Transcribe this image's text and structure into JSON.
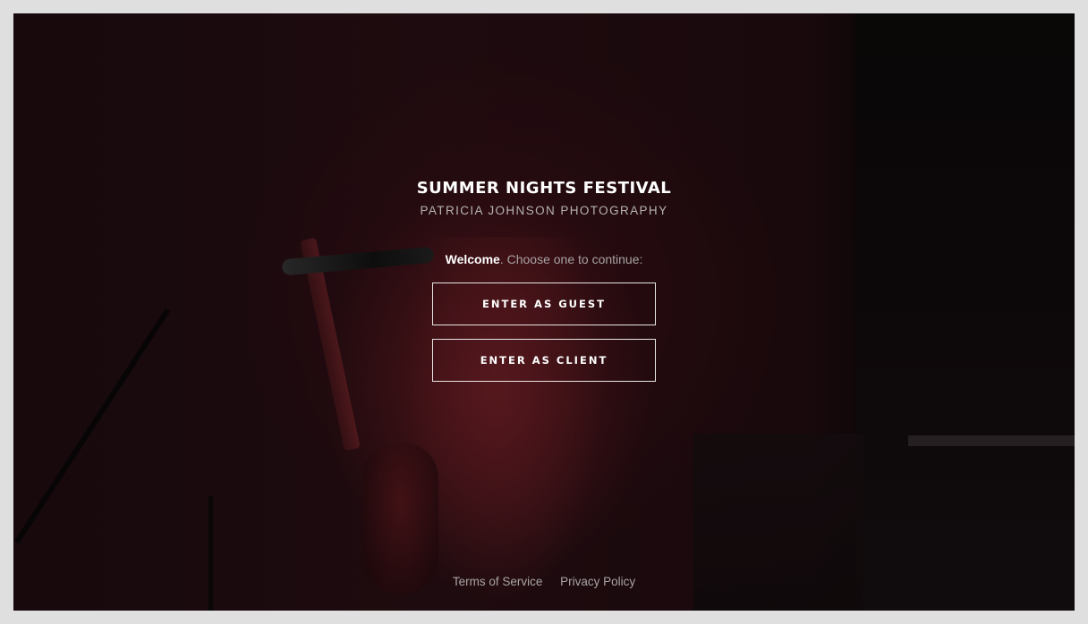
{
  "header": {
    "title": "SUMMER NIGHTS FESTIVAL",
    "subtitle": "PATRICIA JOHNSON PHOTOGRAPHY"
  },
  "welcome": {
    "bold": "Welcome",
    "rest": ". Choose one to continue:"
  },
  "buttons": {
    "guest_label": "ENTER AS GUEST",
    "client_label": "ENTER AS CLIENT"
  },
  "footer": {
    "terms": "Terms of Service",
    "privacy": "Privacy Policy"
  }
}
